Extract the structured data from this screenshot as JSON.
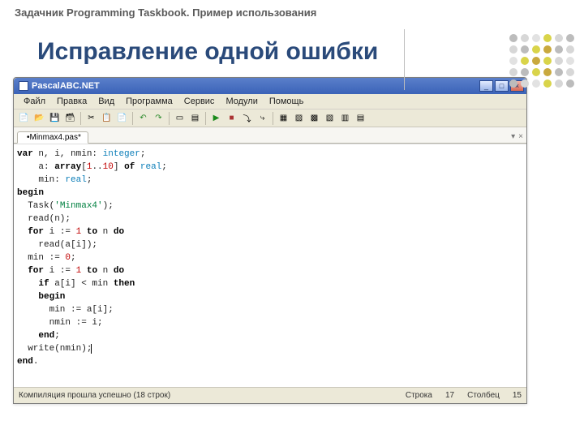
{
  "slide": {
    "header": "Задачник Programming Taskbook. Пример использования",
    "title": "Исправление одной ошибки"
  },
  "titlebar": {
    "label": "PascalABC.NET"
  },
  "winbtns": {
    "min": "_",
    "max": "□",
    "close": "×"
  },
  "menu": {
    "file": "Файл",
    "edit": "Правка",
    "view": "Вид",
    "program": "Программа",
    "service": "Сервис",
    "modules": "Модули",
    "help": "Помощь"
  },
  "tab": {
    "label": "•Minmax4.pas*"
  },
  "tabstrip": {
    "dropdown": "▾",
    "close": "×"
  },
  "code": {
    "l1a": "var",
    "l1b": " n, i, nmin: ",
    "l1c": "integer",
    "l1d": ";",
    "l2a": "    a: ",
    "l2b": "array",
    "l2c": "[",
    "l2d": "1",
    "l2e": "..",
    "l2f": "10",
    "l2g": "] ",
    "l2h": "of",
    "l2i": " ",
    "l2j": "real",
    "l2k": ";",
    "l3a": "    min: ",
    "l3b": "real",
    "l3c": ";",
    "l4": "begin",
    "l5a": "  Task(",
    "l5b": "'Minmax4'",
    "l5c": ");",
    "l6": "  read(n);",
    "l7a": "  ",
    "l7b": "for",
    "l7c": " i := ",
    "l7d": "1",
    "l7e": " ",
    "l7f": "to",
    "l7g": " n ",
    "l7h": "do",
    "l8": "    read(a[i]);",
    "l9a": "  min := ",
    "l9b": "0",
    "l9c": ";",
    "l10a": "  ",
    "l10b": "for",
    "l10c": " i := ",
    "l10d": "1",
    "l10e": " ",
    "l10f": "to",
    "l10g": " n ",
    "l10h": "do",
    "l11a": "    ",
    "l11b": "if",
    "l11c": " a[i] < min ",
    "l11d": "then",
    "l12a": "    ",
    "l12b": "begin",
    "l13": "      min := a[i];",
    "l14": "      nmin := i;",
    "l15a": "    ",
    "l15b": "end",
    "l15c": ";",
    "l16": "  write(nmin);",
    "l17a": "end",
    "l17b": "."
  },
  "status": {
    "msg": "Компиляция прошла успешно (18 строк)",
    "line_lbl": "Строка",
    "line_val": "17",
    "col_lbl": "Столбец",
    "col_val": "15"
  },
  "icons": {
    "new": "📄",
    "open": "📂",
    "save": "💾",
    "saveall": "🗃",
    "cut": "✂",
    "copy": "📋",
    "paste": "📄",
    "undo": "↶",
    "redo": "↷",
    "newform": "▭",
    "props": "▤",
    "run": "▶",
    "stop": "■",
    "stepinto": "⤵",
    "stepover": "⤷",
    "m1": "▦",
    "m2": "▨",
    "m3": "▩",
    "m4": "▧",
    "m5": "▥",
    "m6": "▤"
  }
}
